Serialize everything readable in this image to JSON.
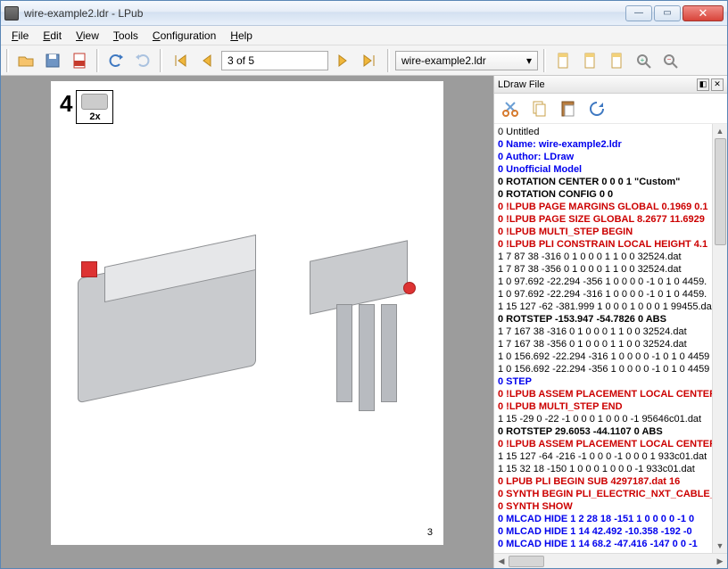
{
  "titlebar": {
    "text": "wire-example2.ldr - LPub"
  },
  "menus": [
    "File",
    "Edit",
    "View",
    "Tools",
    "Configuration",
    "Help"
  ],
  "page_info": "3 of 5",
  "model_selector": "wire-example2.ldr",
  "page": {
    "step_number": "4",
    "pli_qty": "2x",
    "page_number": "3"
  },
  "panel": {
    "title": "LDraw File"
  },
  "code_lines": [
    {
      "cls": "c-black",
      "text": "0 Untitled"
    },
    {
      "cls": "c-blue",
      "text": "0 Name: wire-example2.ldr"
    },
    {
      "cls": "c-blue",
      "text": "0 Author: LDraw"
    },
    {
      "cls": "c-blue",
      "text": "0 Unofficial Model"
    },
    {
      "cls": "c-dk",
      "text": "0 ROTATION CENTER 0 0 0 1 \"Custom\""
    },
    {
      "cls": "c-dk",
      "text": "0 ROTATION CONFIG 0 0"
    },
    {
      "cls": "c-red",
      "text": "0 !LPUB PAGE MARGINS GLOBAL 0.1969 0.1"
    },
    {
      "cls": "c-red",
      "text": "0 !LPUB PAGE SIZE GLOBAL 8.2677 11.6929"
    },
    {
      "cls": "c-red",
      "text": "0 !LPUB MULTI_STEP BEGIN"
    },
    {
      "cls": "c-red",
      "text": "0 !LPUB PLI CONSTRAIN LOCAL HEIGHT 4.1"
    },
    {
      "cls": "c-black",
      "text": "1 7 87 38 -316 0 1 0 0 0 1 1 0 0 32524.dat"
    },
    {
      "cls": "c-black",
      "text": "1 7 87 38 -356 0 1 0 0 0 1 1 0 0 32524.dat"
    },
    {
      "cls": "c-black",
      "text": "1 0 97.692 -22.294 -356 1 0 0 0 0 -1 0 1 0 4459."
    },
    {
      "cls": "c-black",
      "text": "1 0 97.692 -22.294 -316 1 0 0 0 0 -1 0 1 0 4459."
    },
    {
      "cls": "c-black",
      "text": "1 15 127 -62 -381.999 1 0 0 0 1 0 0 0 1 99455.da"
    },
    {
      "cls": "c-dk",
      "text": "0 ROTSTEP -153.947 -54.7826 0 ABS"
    },
    {
      "cls": "c-black",
      "text": "1 7 167 38 -316 0 1 0 0 0 1 1 0 0 32524.dat"
    },
    {
      "cls": "c-black",
      "text": "1 7 167 38 -356 0 1 0 0 0 1 1 0 0 32524.dat"
    },
    {
      "cls": "c-black",
      "text": "1 0 156.692 -22.294 -316 1 0 0 0 0 -1 0 1 0 4459"
    },
    {
      "cls": "c-black",
      "text": "1 0 156.692 -22.294 -356 1 0 0 0 0 -1 0 1 0 4459"
    },
    {
      "cls": "c-blue",
      "text": "0 STEP"
    },
    {
      "cls": "c-red",
      "text": "0 !LPUB ASSEM PLACEMENT LOCAL CENTER"
    },
    {
      "cls": "c-red",
      "text": "0 !LPUB MULTI_STEP END"
    },
    {
      "cls": "c-black",
      "text": "1 15 -29 0 -22 -1 0 0 0 1 0 0 0 -1 95646c01.dat"
    },
    {
      "cls": "c-dk",
      "text": "0 ROTSTEP 29.6053 -44.1107 0 ABS"
    },
    {
      "cls": "c-red",
      "text": "0 !LPUB ASSEM PLACEMENT LOCAL CENTER"
    },
    {
      "cls": "c-black",
      "text": "1 15 127 -64 -216 -1 0 0 0 -1 0 0 0 1 933c01.dat"
    },
    {
      "cls": "c-black",
      "text": "1 15 32 18 -150 1 0 0 0 1 0 0 0 -1 933c01.dat"
    },
    {
      "cls": "c-red",
      "text": "0 LPUB PLI BEGIN SUB 4297187.dat 16"
    },
    {
      "cls": "c-red",
      "text": "0 SYNTH BEGIN PLI_ELECTRIC_NXT_CABLE_"
    },
    {
      "cls": "c-red",
      "text": "0 SYNTH SHOW"
    },
    {
      "cls": "c-blue",
      "text": "0  MLCAD HIDE 1 2 28 18 -151 1 0 0 0 0 -1 0"
    },
    {
      "cls": "c-blue",
      "text": "0  MLCAD HIDE 1 14 42.492 -10.358 -192 -0"
    },
    {
      "cls": "c-blue",
      "text": "0  MLCAD HIDE 1 14 68.2 -47.416 -147 0 0 -1"
    }
  ]
}
